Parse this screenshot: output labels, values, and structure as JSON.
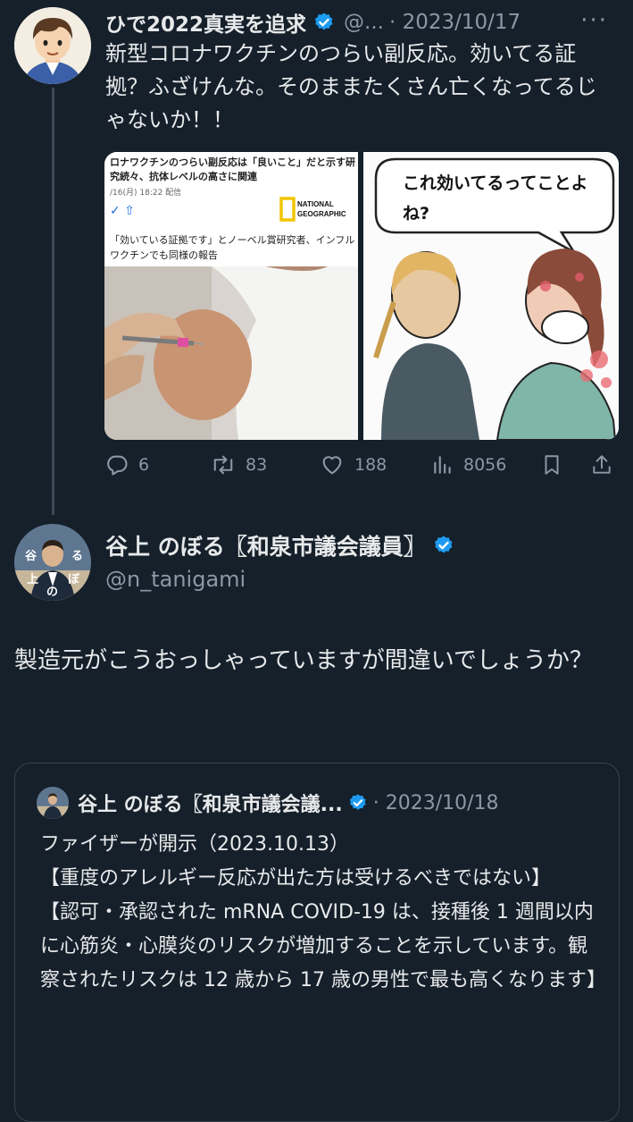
{
  "colors": {
    "background": "#15202b",
    "text": "#e7e9ea",
    "muted": "#8b98a5",
    "verified": "#1d9bf0",
    "border": "#38444d"
  },
  "tweet1": {
    "display_name": "ひで2022真実を追求",
    "handle": "@...",
    "date": "· 2023/10/17",
    "more": "···",
    "text": "新型コロナワクチンのつらい副反応。効いてる証拠？ふざけんな。そのままたくさん亡くなってるじゃないか！！",
    "media": {
      "news_headline": "ロナワクチンのつらい副反応は「良いこと」だと示す研究続々、抗体レベルの高さに関連",
      "news_date": "/16(月) 18:22 配信",
      "news_logo": "NATIONAL GEOGRAPHIC",
      "news_sub": "「効いている証拠です」とノーベル賞研究者、インフルワクチンでも同様の報告",
      "bubble_text": "これ効いてるってことよね?"
    },
    "actions": {
      "replies": "6",
      "retweets": "83",
      "likes": "188",
      "views": "8056"
    }
  },
  "tweet2": {
    "display_name": "谷上 のぼる〖和泉市議会議員〗",
    "handle": "@n_tanigami",
    "avatar_text": "谷上のぼる",
    "text": "製造元がこうおっしゃっていますが間違いでしょうか？",
    "quote": {
      "display_name": "谷上 のぼる〖和泉市議会議...",
      "date": "· 2023/10/18",
      "lines": [
        "ファイザーが開示（2023.10.13）",
        "【重度のアレルギー反応が出た方は受けるべきではない】",
        "【認可・承認された mRNA COVID-19 は、接種後 1 週間以内に心筋炎・心膜炎のリスクが増加することを示しています。観察されたリスクは 12 歳から 17 歳の男性で最も高くなります】"
      ]
    }
  }
}
